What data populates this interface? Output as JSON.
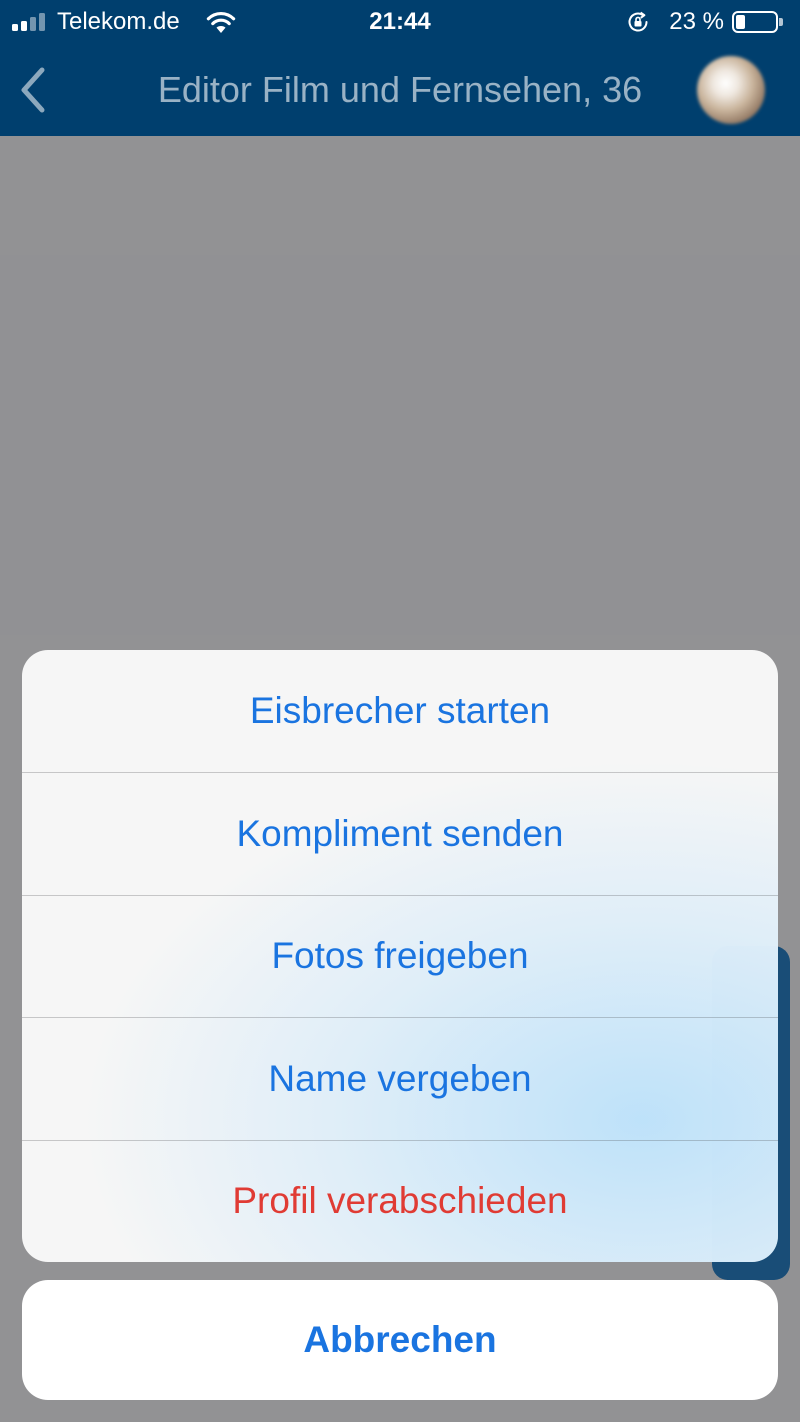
{
  "status_bar": {
    "carrier": "Telekom.de",
    "time": "21:44",
    "battery_percent": "23 %",
    "battery_level": 0.23,
    "signal_bars": 2,
    "icons": [
      "signal-icon",
      "wifi-icon",
      "orientation-lock-icon",
      "battery-icon"
    ]
  },
  "nav": {
    "title": "Editor Film und Fernsehen, 36",
    "back_icon": "chevron-left-icon",
    "avatar_icon": "avatar"
  },
  "action_sheet": {
    "items": [
      {
        "label": "Eisbrecher starten",
        "style": "default"
      },
      {
        "label": "Kompliment senden",
        "style": "default"
      },
      {
        "label": "Fotos freigeben",
        "style": "default"
      },
      {
        "label": "Name vergeben",
        "style": "default"
      },
      {
        "label": "Profil verabschieden",
        "style": "destructive"
      }
    ],
    "cancel_label": "Abbrechen"
  },
  "colors": {
    "nav_background": "#003f6e",
    "action_text": "#1a74e0",
    "destructive_text": "#e03b34",
    "overlay": "#16161a"
  }
}
